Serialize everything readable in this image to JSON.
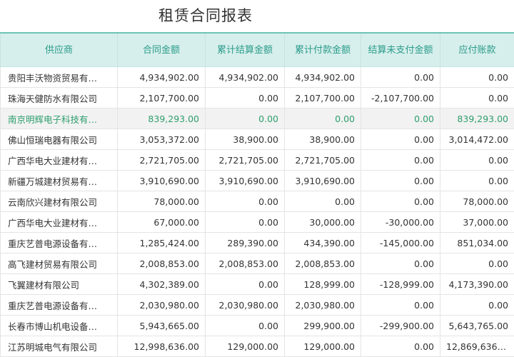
{
  "title": "租赁合同报表",
  "columns": [
    "供应商",
    "合同金额",
    "累计结算金额",
    "累计付款金额",
    "结算未支付金额",
    "应付账款"
  ],
  "rows": [
    {
      "supplier": "贵阳丰沃物资贸易有…",
      "contract": "4,934,902.00",
      "settled": "4,934,902.00",
      "paid": "4,934,902.00",
      "unpaid": "0.00",
      "payable": "0.00",
      "selected": false
    },
    {
      "supplier": "珠海天健防水有限公司",
      "contract": "2,107,700.00",
      "settled": "0.00",
      "paid": "2,107,700.00",
      "unpaid": "-2,107,700.00",
      "payable": "0.00",
      "selected": false
    },
    {
      "supplier": "南京明辉电子科技有…",
      "contract": "839,293.00",
      "settled": "0.00",
      "paid": "0.00",
      "unpaid": "0.00",
      "payable": "839,293.00",
      "selected": true
    },
    {
      "supplier": "佛山恒瑞电器有限公司",
      "contract": "3,053,372.00",
      "settled": "38,900.00",
      "paid": "38,900.00",
      "unpaid": "0.00",
      "payable": "3,014,472.00",
      "selected": false
    },
    {
      "supplier": "广西华电大业建材有…",
      "contract": "2,721,705.00",
      "settled": "2,721,705.00",
      "paid": "2,721,705.00",
      "unpaid": "0.00",
      "payable": "0.00",
      "selected": false
    },
    {
      "supplier": "新疆万城建材贸易有…",
      "contract": "3,910,690.00",
      "settled": "3,910,690.00",
      "paid": "3,910,690.00",
      "unpaid": "0.00",
      "payable": "0.00",
      "selected": false
    },
    {
      "supplier": "云南欣兴建材有限公司",
      "contract": "78,000.00",
      "settled": "0.00",
      "paid": "0.00",
      "unpaid": "0.00",
      "payable": "78,000.00",
      "selected": false
    },
    {
      "supplier": "广西华电大业建材有…",
      "contract": "67,000.00",
      "settled": "0.00",
      "paid": "30,000.00",
      "unpaid": "-30,000.00",
      "payable": "37,000.00",
      "selected": false
    },
    {
      "supplier": "重庆艺普电源设备有…",
      "contract": "1,285,424.00",
      "settled": "289,390.00",
      "paid": "434,390.00",
      "unpaid": "-145,000.00",
      "payable": "851,034.00",
      "selected": false
    },
    {
      "supplier": "高飞建材贸易有限公司",
      "contract": "2,008,853.00",
      "settled": "2,008,853.00",
      "paid": "2,008,853.00",
      "unpaid": "0.00",
      "payable": "0.00",
      "selected": false
    },
    {
      "supplier": "飞翼建材有限公司",
      "contract": "4,302,389.00",
      "settled": "0.00",
      "paid": "128,999.00",
      "unpaid": "-128,999.00",
      "payable": "4,173,390.00",
      "selected": false
    },
    {
      "supplier": "重庆艺普电源设备有…",
      "contract": "2,030,980.00",
      "settled": "2,030,980.00",
      "paid": "2,030,980.00",
      "unpaid": "0.00",
      "payable": "0.00",
      "selected": false
    },
    {
      "supplier": "长春市博山机电设备…",
      "contract": "5,943,665.00",
      "settled": "0.00",
      "paid": "299,900.00",
      "unpaid": "-299,900.00",
      "payable": "5,643,765.00",
      "selected": false
    },
    {
      "supplier": "江苏明城电气有限公司",
      "contract": "12,998,636.00",
      "settled": "129,000.00",
      "paid": "129,000.00",
      "unpaid": "0.00",
      "payable": "12,869,636....",
      "selected": false
    }
  ]
}
